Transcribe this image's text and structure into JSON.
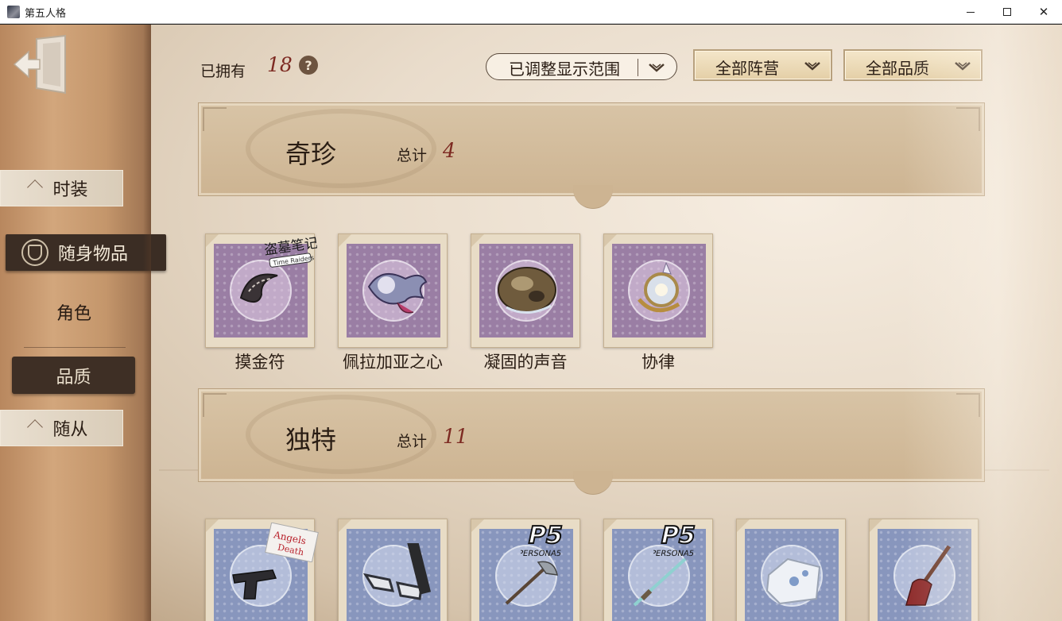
{
  "window": {
    "title": "第五人格",
    "minimize_icon": "minimize-icon",
    "maximize_icon": "maximize-icon",
    "close_icon": "close-icon"
  },
  "sidebar": {
    "exit_icon": "exit-door-icon",
    "items": [
      {
        "label": "时装",
        "state": "inactive"
      },
      {
        "label": "随身物品",
        "state": "selected",
        "icon": "crest-icon"
      },
      {
        "label": "角色",
        "state": "inactive"
      },
      {
        "label": "品质",
        "state": "active-subtab"
      },
      {
        "label": "随从",
        "state": "inactive"
      }
    ]
  },
  "toolbar": {
    "owned_label": "已拥有",
    "owned_count": "18",
    "help_icon": "?",
    "range_filter": "已调整显示范围",
    "faction_filter": "全部阵营",
    "quality_filter": "全部品质"
  },
  "sections": [
    {
      "title": "奇珍",
      "total_label": "总计",
      "total_count": "4",
      "items": [
        {
          "name": "摸金符",
          "stamp_color": "purple",
          "badge": "盗墓笔记 Time Raiders"
        },
        {
          "name": "佩拉加亚之心",
          "stamp_color": "purple"
        },
        {
          "name": "凝固的声音",
          "stamp_color": "purple"
        },
        {
          "name": "协律",
          "stamp_color": "purple"
        }
      ]
    },
    {
      "title": "独特",
      "total_label": "总计",
      "total_count": "11",
      "items": [
        {
          "name": "",
          "stamp_color": "blue",
          "badge": "Angels of Death"
        },
        {
          "name": "",
          "stamp_color": "blue"
        },
        {
          "name": "",
          "stamp_color": "blue",
          "badge": "P5 PERSONA5"
        },
        {
          "name": "",
          "stamp_color": "blue",
          "badge": "P5 PERSONA5"
        },
        {
          "name": "",
          "stamp_color": "blue"
        },
        {
          "name": "",
          "stamp_color": "blue"
        }
      ]
    }
  ],
  "colors": {
    "accent_red": "#7d2a22",
    "text_dark": "#2a1d14",
    "stamp_purple": "#9a7ea4",
    "stamp_blue": "#8896bd"
  }
}
